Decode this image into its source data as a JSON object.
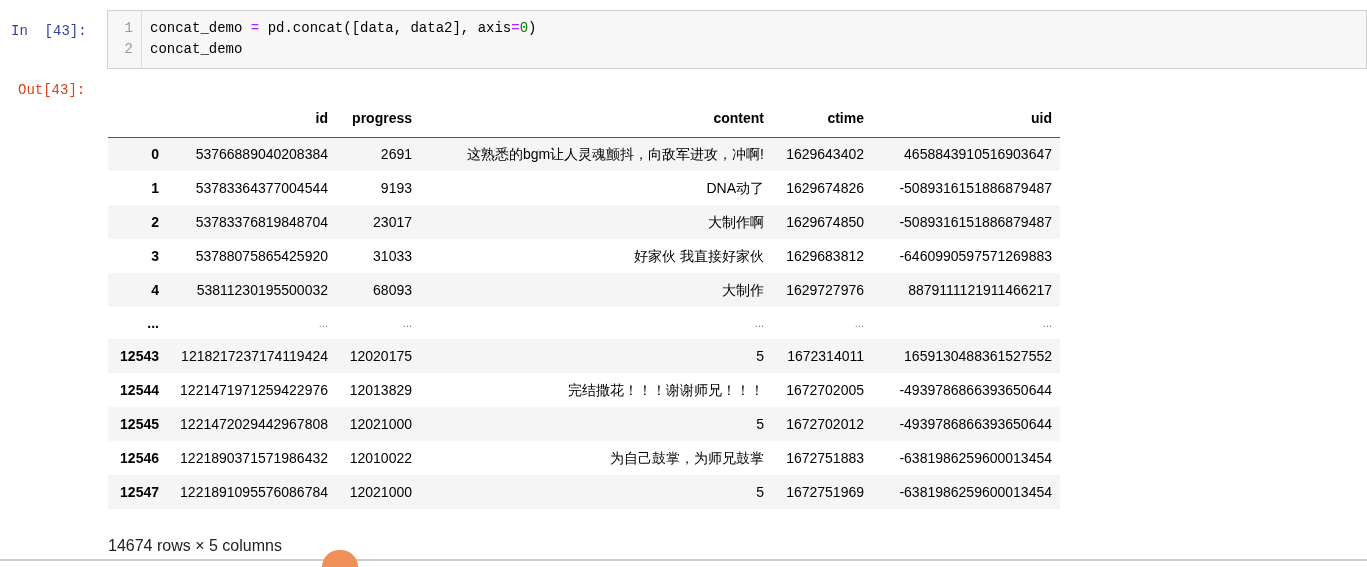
{
  "input_cell": {
    "prompt": "In  [43]:",
    "lines": [
      {
        "number": "1",
        "tokens": [
          {
            "text": "concat_demo ",
            "kind": "name"
          },
          {
            "text": "=",
            "kind": "operator"
          },
          {
            "text": " pd.concat([data, data2], axis",
            "kind": "name"
          },
          {
            "text": "=",
            "kind": "operator"
          },
          {
            "text": "0",
            "kind": "number"
          },
          {
            "text": ")",
            "kind": "name"
          }
        ]
      },
      {
        "number": "2",
        "tokens": [
          {
            "text": "concat_demo",
            "kind": "name"
          }
        ]
      }
    ]
  },
  "output_cell": {
    "prompt": "Out[43]:",
    "table": {
      "columns": [
        "",
        "id",
        "progress",
        "content",
        "ctime",
        "uid"
      ],
      "rows": [
        {
          "kind": "data",
          "cells": [
            "0",
            "53766889040208384",
            "2691",
            "这熟悉的bgm让人灵魂颤抖，向敌军进攻，冲啊!",
            "1629643402",
            "4658843910516903647"
          ]
        },
        {
          "kind": "data",
          "cells": [
            "1",
            "53783364377004544",
            "9193",
            "DNA动了",
            "1629674826",
            "-5089316151886879487"
          ]
        },
        {
          "kind": "data",
          "cells": [
            "2",
            "53783376819848704",
            "23017",
            "大制作啊",
            "1629674850",
            "-5089316151886879487"
          ]
        },
        {
          "kind": "data",
          "cells": [
            "3",
            "53788075865425920",
            "31033",
            "好家伙 我直接好家伙",
            "1629683812",
            "-6460990597571269883"
          ]
        },
        {
          "kind": "data",
          "cells": [
            "4",
            "53811230195500032",
            "68093",
            "大制作",
            "1629727976",
            "8879111121911466217"
          ]
        },
        {
          "kind": "ellipsis",
          "cells": [
            "...",
            "...",
            "...",
            "...",
            "...",
            "..."
          ]
        },
        {
          "kind": "data",
          "cells": [
            "12543",
            "1218217237174119424",
            "12020175",
            "5",
            "1672314011",
            "1659130488361527552"
          ]
        },
        {
          "kind": "data",
          "cells": [
            "12544",
            "1221471971259422976",
            "12013829",
            "完结撒花！！！谢谢师兄！！！",
            "1672702005",
            "-4939786866393650644"
          ]
        },
        {
          "kind": "data",
          "cells": [
            "12545",
            "1221472029442967808",
            "12021000",
            "5",
            "1672702012",
            "-4939786866393650644"
          ]
        },
        {
          "kind": "data",
          "cells": [
            "12546",
            "1221890371571986432",
            "12010022",
            "为自己鼓掌，为师兄鼓掌",
            "1672751883",
            "-6381986259600013454"
          ]
        },
        {
          "kind": "data",
          "cells": [
            "12547",
            "1221891095576086784",
            "12021000",
            "5",
            "1672751969",
            "-6381986259600013454"
          ]
        }
      ],
      "summary": "14674 rows × 5 columns"
    }
  }
}
